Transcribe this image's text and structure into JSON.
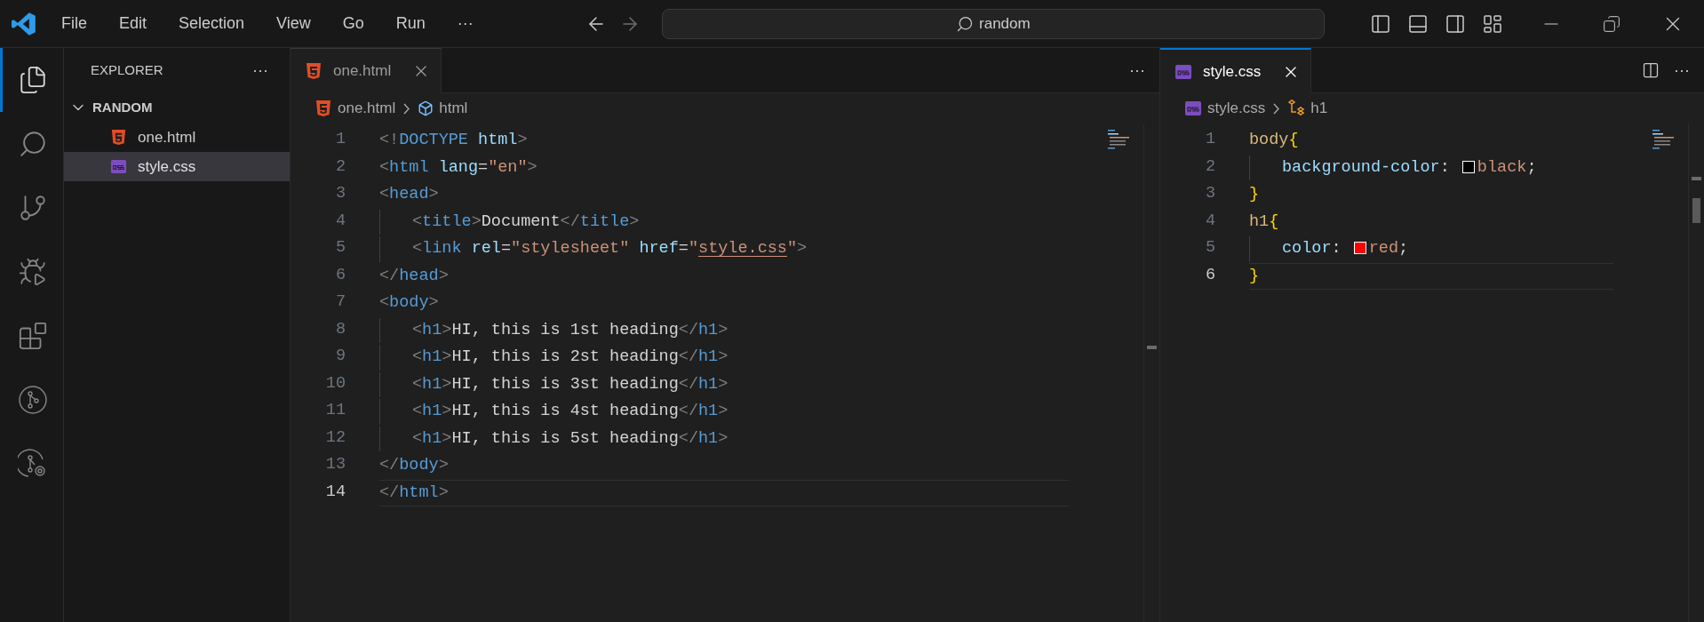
{
  "menu": [
    "File",
    "Edit",
    "Selection",
    "View",
    "Go",
    "Run",
    "···"
  ],
  "command_center": {
    "value": "random"
  },
  "activity_bar": [
    {
      "kind": "explorer",
      "selected": true
    },
    {
      "kind": "search",
      "selected": false
    },
    {
      "kind": "source-control",
      "selected": false
    },
    {
      "kind": "run-debug",
      "selected": false
    },
    {
      "kind": "extensions",
      "selected": false
    },
    {
      "kind": "remote",
      "selected": false
    },
    {
      "kind": "git-graph",
      "selected": false
    }
  ],
  "explorer": {
    "title": "EXPLORER",
    "more": "···",
    "folder": {
      "name": "RANDOM",
      "expanded": true,
      "children": [
        {
          "name": "one.html",
          "kind": "html",
          "selected": false
        },
        {
          "name": "style.css",
          "kind": "css",
          "selected": true
        }
      ]
    }
  },
  "editors": [
    {
      "focused": false,
      "more": "···",
      "tabs": [
        {
          "name": "one.html",
          "kind": "html",
          "selected": true
        }
      ],
      "breadcrumb": [
        {
          "text": "one.html",
          "kind": "html"
        },
        {
          "text": "html",
          "kind": "element"
        }
      ],
      "lines": [
        {
          "number": "1",
          "current": false,
          "indented": false,
          "tokens": [
            {
              "kind": "punct",
              "text": "<!"
            },
            {
              "kind": "tag",
              "text": "DOCTYPE"
            },
            {
              "kind": "attr",
              "text": " html"
            },
            {
              "kind": "punct",
              "text": ">"
            }
          ]
        },
        {
          "number": "2",
          "current": false,
          "indented": false,
          "tokens": [
            {
              "kind": "punct",
              "text": "<"
            },
            {
              "kind": "tag",
              "text": "html"
            },
            {
              "kind": "attr",
              "text": " lang"
            },
            {
              "kind": "text",
              "text": "="
            },
            {
              "kind": "string",
              "text": "\"en\""
            },
            {
              "kind": "punct",
              "text": ">"
            }
          ]
        },
        {
          "number": "3",
          "current": false,
          "indented": false,
          "tokens": [
            {
              "kind": "punct",
              "text": "<"
            },
            {
              "kind": "tag",
              "text": "head"
            },
            {
              "kind": "punct",
              "text": ">"
            }
          ]
        },
        {
          "number": "4",
          "current": false,
          "indented": true,
          "tokens": [
            {
              "kind": "punct",
              "text": "<"
            },
            {
              "kind": "tag",
              "text": "title"
            },
            {
              "kind": "punct",
              "text": ">"
            },
            {
              "kind": "text",
              "text": "Document"
            },
            {
              "kind": "punct",
              "text": "</"
            },
            {
              "kind": "tag",
              "text": "title"
            },
            {
              "kind": "punct",
              "text": ">"
            }
          ]
        },
        {
          "number": "5",
          "current": false,
          "indented": true,
          "tokens": [
            {
              "kind": "punct",
              "text": "<"
            },
            {
              "kind": "tag",
              "text": "link"
            },
            {
              "kind": "attr",
              "text": " rel"
            },
            {
              "kind": "text",
              "text": "="
            },
            {
              "kind": "string",
              "text": "\"stylesheet\""
            },
            {
              "kind": "attr",
              "text": " href"
            },
            {
              "kind": "text",
              "text": "="
            },
            {
              "kind": "string",
              "text": "\""
            },
            {
              "kind": "link",
              "text": "style.css"
            },
            {
              "kind": "string",
              "text": "\""
            },
            {
              "kind": "punct",
              "text": ">"
            }
          ]
        },
        {
          "number": "6",
          "current": false,
          "indented": false,
          "tokens": [
            {
              "kind": "punct",
              "text": "</"
            },
            {
              "kind": "tag",
              "text": "head"
            },
            {
              "kind": "punct",
              "text": ">"
            }
          ]
        },
        {
          "number": "7",
          "current": false,
          "indented": false,
          "tokens": [
            {
              "kind": "punct",
              "text": "<"
            },
            {
              "kind": "tag",
              "text": "body"
            },
            {
              "kind": "punct",
              "text": ">"
            }
          ]
        },
        {
          "number": "8",
          "current": false,
          "indented": true,
          "tokens": [
            {
              "kind": "punct",
              "text": "<"
            },
            {
              "kind": "tag",
              "text": "h1"
            },
            {
              "kind": "punct",
              "text": ">"
            },
            {
              "kind": "text",
              "text": "HI, this is 1st heading"
            },
            {
              "kind": "punct",
              "text": "</"
            },
            {
              "kind": "tag",
              "text": "h1"
            },
            {
              "kind": "punct",
              "text": ">"
            }
          ]
        },
        {
          "number": "9",
          "current": false,
          "indented": true,
          "tokens": [
            {
              "kind": "punct",
              "text": "<"
            },
            {
              "kind": "tag",
              "text": "h1"
            },
            {
              "kind": "punct",
              "text": ">"
            },
            {
              "kind": "text",
              "text": "HI, this is 2st heading"
            },
            {
              "kind": "punct",
              "text": "</"
            },
            {
              "kind": "tag",
              "text": "h1"
            },
            {
              "kind": "punct",
              "text": ">"
            }
          ]
        },
        {
          "number": "10",
          "current": false,
          "indented": true,
          "tokens": [
            {
              "kind": "punct",
              "text": "<"
            },
            {
              "kind": "tag",
              "text": "h1"
            },
            {
              "kind": "punct",
              "text": ">"
            },
            {
              "kind": "text",
              "text": "HI, this is 3st heading"
            },
            {
              "kind": "punct",
              "text": "</"
            },
            {
              "kind": "tag",
              "text": "h1"
            },
            {
              "kind": "punct",
              "text": ">"
            }
          ]
        },
        {
          "number": "11",
          "current": false,
          "indented": true,
          "tokens": [
            {
              "kind": "punct",
              "text": "<"
            },
            {
              "kind": "tag",
              "text": "h1"
            },
            {
              "kind": "punct",
              "text": ">"
            },
            {
              "kind": "text",
              "text": "HI, this is 4st heading"
            },
            {
              "kind": "punct",
              "text": "</"
            },
            {
              "kind": "tag",
              "text": "h1"
            },
            {
              "kind": "punct",
              "text": ">"
            }
          ]
        },
        {
          "number": "12",
          "current": false,
          "indented": true,
          "tokens": [
            {
              "kind": "punct",
              "text": "<"
            },
            {
              "kind": "tag",
              "text": "h1"
            },
            {
              "kind": "punct",
              "text": ">"
            },
            {
              "kind": "text",
              "text": "HI, this is 5st heading"
            },
            {
              "kind": "punct",
              "text": "</"
            },
            {
              "kind": "tag",
              "text": "h1"
            },
            {
              "kind": "punct",
              "text": ">"
            }
          ]
        },
        {
          "number": "13",
          "current": false,
          "indented": false,
          "tokens": [
            {
              "kind": "punct",
              "text": "</"
            },
            {
              "kind": "tag",
              "text": "body"
            },
            {
              "kind": "punct",
              "text": ">"
            }
          ]
        },
        {
          "number": "14",
          "current": true,
          "indented": false,
          "tokens": [
            {
              "kind": "punct",
              "text": "</"
            },
            {
              "kind": "tag",
              "text": "html"
            },
            {
              "kind": "punct",
              "text": ">"
            }
          ]
        }
      ]
    },
    {
      "focused": true,
      "more": "···",
      "tabs": [
        {
          "name": "style.css",
          "kind": "css",
          "selected": true
        }
      ],
      "breadcrumb": [
        {
          "text": "style.css",
          "kind": "css"
        },
        {
          "text": "h1",
          "kind": "selector"
        }
      ],
      "lines": [
        {
          "number": "1",
          "current": false,
          "indented": false,
          "tokens": [
            {
              "kind": "selector",
              "text": "body"
            },
            {
              "kind": "brace",
              "text": "{"
            }
          ]
        },
        {
          "number": "2",
          "current": false,
          "indented": true,
          "tokens": [
            {
              "kind": "attr",
              "text": "background-color"
            },
            {
              "kind": "text",
              "text": ": "
            },
            {
              "kind": "swatch",
              "color": "#000000"
            },
            {
              "kind": "string",
              "text": "black"
            },
            {
              "kind": "text",
              "text": ";"
            }
          ]
        },
        {
          "number": "3",
          "current": false,
          "indented": false,
          "tokens": [
            {
              "kind": "brace",
              "text": "}"
            }
          ]
        },
        {
          "number": "4",
          "current": false,
          "indented": false,
          "tokens": [
            {
              "kind": "selector",
              "text": "h1"
            },
            {
              "kind": "brace",
              "text": "{"
            }
          ]
        },
        {
          "number": "5",
          "current": false,
          "indented": true,
          "tokens": [
            {
              "kind": "attr",
              "text": "color"
            },
            {
              "kind": "text",
              "text": ": "
            },
            {
              "kind": "swatch",
              "color": "#ff0000"
            },
            {
              "kind": "string",
              "text": "red"
            },
            {
              "kind": "text",
              "text": ";"
            }
          ]
        },
        {
          "number": "6",
          "current": true,
          "indented": false,
          "tokens": [
            {
              "kind": "brace",
              "text": "}"
            }
          ]
        }
      ]
    }
  ]
}
